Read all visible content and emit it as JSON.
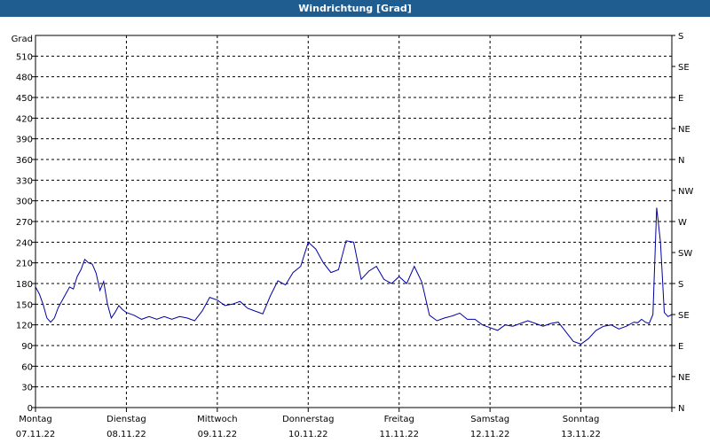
{
  "window": {
    "title": "Windrichtung [Grad]"
  },
  "chart_data": {
    "type": "line",
    "title": "Windrichtung [Grad]",
    "ylabel": "Grad",
    "ylim": [
      0,
      540
    ],
    "yticks": [
      0,
      30,
      60,
      90,
      120,
      150,
      180,
      210,
      240,
      270,
      300,
      330,
      360,
      390,
      420,
      450,
      480,
      510
    ],
    "right_ticks": [
      "N",
      "NE",
      "E",
      "SE",
      "S",
      "SW",
      "W",
      "NW",
      "N",
      "NE",
      "E",
      "SE",
      "S"
    ],
    "grid": true,
    "line_color": "#0000a0",
    "x_range": [
      "07.11.22 00:00",
      "14.11.22 00:00"
    ],
    "days": [
      {
        "weekday": "Montag",
        "date": "07.11.22"
      },
      {
        "weekday": "Dienstag",
        "date": "08.11.22"
      },
      {
        "weekday": "Mittwoch",
        "date": "09.11.22"
      },
      {
        "weekday": "Donnerstag",
        "date": "10.11.22"
      },
      {
        "weekday": "Freitag",
        "date": "11.11.22"
      },
      {
        "weekday": "Samstag",
        "date": "12.11.22"
      },
      {
        "weekday": "Sonntag",
        "date": "13.11.22"
      }
    ],
    "series": [
      {
        "x": [
          "07.11.22 00:00",
          "07.11.22 01:00",
          "07.11.22 02:00",
          "07.11.22 03:00",
          "07.11.22 04:00",
          "07.11.22 05:00",
          "07.11.22 06:00",
          "07.11.22 07:00",
          "07.11.22 08:00",
          "07.11.22 09:00",
          "07.11.22 10:00",
          "07.11.22 11:00",
          "07.11.22 12:00",
          "07.11.22 13:00",
          "07.11.22 14:00",
          "07.11.22 15:00",
          "07.11.22 16:00",
          "07.11.22 17:00",
          "07.11.22 18:00",
          "07.11.22 19:00",
          "07.11.22 20:00",
          "07.11.22 21:00",
          "07.11.22 22:00",
          "07.11.22 23:00",
          "08.11.22 00:00",
          "08.11.22 02:00",
          "08.11.22 04:00",
          "08.11.22 06:00",
          "08.11.22 08:00",
          "08.11.22 10:00",
          "08.11.22 12:00",
          "08.11.22 14:00",
          "08.11.22 16:00",
          "08.11.22 18:00",
          "08.11.22 20:00",
          "08.11.22 22:00",
          "09.11.22 00:00",
          "09.11.22 02:00",
          "09.11.22 04:00",
          "09.11.22 06:00",
          "09.11.22 08:00",
          "09.11.22 10:00",
          "09.11.22 12:00",
          "09.11.22 14:00",
          "09.11.22 16:00",
          "09.11.22 18:00",
          "09.11.22 20:00",
          "09.11.22 22:00",
          "10.11.22 00:00",
          "10.11.22 02:00",
          "10.11.22 04:00",
          "10.11.22 06:00",
          "10.11.22 08:00",
          "10.11.22 10:00",
          "10.11.22 12:00",
          "10.11.22 14:00",
          "10.11.22 16:00",
          "10.11.22 18:00",
          "10.11.22 20:00",
          "10.11.22 22:00",
          "11.11.22 00:00",
          "11.11.22 02:00",
          "11.11.22 04:00",
          "11.11.22 06:00",
          "11.11.22 08:00",
          "11.11.22 10:00",
          "11.11.22 12:00",
          "11.11.22 14:00",
          "11.11.22 16:00",
          "11.11.22 18:00",
          "11.11.22 20:00",
          "11.11.22 22:00",
          "12.11.22 00:00",
          "12.11.22 02:00",
          "12.11.22 04:00",
          "12.11.22 06:00",
          "12.11.22 08:00",
          "12.11.22 10:00",
          "12.11.22 12:00",
          "12.11.22 14:00",
          "12.11.22 16:00",
          "12.11.22 18:00",
          "12.11.22 20:00",
          "12.11.22 22:00",
          "13.11.22 00:00",
          "13.11.22 02:00",
          "13.11.22 04:00",
          "13.11.22 06:00",
          "13.11.22 08:00",
          "13.11.22 10:00",
          "13.11.22 12:00",
          "13.11.22 14:00",
          "13.11.22 15:00",
          "13.11.22 16:00",
          "13.11.22 17:00",
          "13.11.22 18:00",
          "13.11.22 19:00",
          "13.11.22 20:00",
          "13.11.22 21:00",
          "13.11.22 22:00",
          "13.11.22 23:00",
          "14.11.22 00:00"
        ],
        "values": [
          175,
          165,
          150,
          130,
          124,
          130,
          145,
          155,
          165,
          175,
          172,
          190,
          200,
          215,
          210,
          208,
          195,
          170,
          183,
          150,
          130,
          138,
          148,
          142,
          138,
          134,
          128,
          132,
          128,
          132,
          128,
          132,
          130,
          126,
          140,
          160,
          156,
          148,
          150,
          154,
          144,
          140,
          136,
          162,
          184,
          178,
          196,
          205,
          240,
          230,
          210,
          196,
          200,
          242,
          240,
          186,
          198,
          205,
          186,
          180,
          190,
          180,
          205,
          182,
          134,
          126,
          130,
          133,
          137,
          128,
          128,
          120,
          116,
          112,
          120,
          118,
          122,
          126,
          122,
          118,
          122,
          124,
          110,
          96,
          92,
          100,
          112,
          118,
          120,
          114,
          118,
          124,
          123,
          128,
          124,
          122,
          135,
          290,
          240,
          138,
          132,
          135
        ]
      }
    ]
  }
}
